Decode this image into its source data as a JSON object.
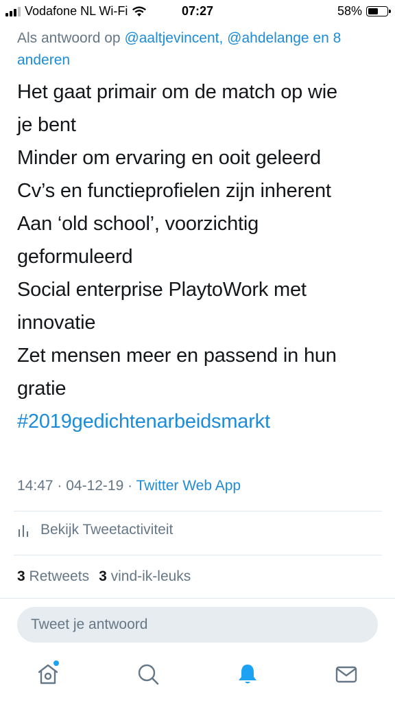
{
  "status_bar": {
    "carrier": "Vodafone NL Wi-Fi",
    "time": "07:27",
    "battery_percent": "58%",
    "battery_level": 0.58,
    "signal_bars_filled": 3,
    "signal_bars_total": 4
  },
  "tweet": {
    "reply_prefix": "Als antwoord op ",
    "reply_mentions": "@aaltjevincent, @ahdelange en 8 anderen",
    "lines": [
      "Het gaat primair om de match op wie",
      "je bent",
      "Minder om ervaring en ooit geleerd",
      "Cv’s en functieprofielen zijn inherent",
      "Aan ‘old school’, voorzichtig",
      "geformuleerd",
      "Social enterprise PlaytoWork met",
      "innovatie",
      "Zet mensen meer en passend in hun",
      "gratie"
    ],
    "hashtag": "#2019gedichtenarbeidsmarkt",
    "timestamp": "14:47 · 04-12-19 · ",
    "source": "Twitter Web App"
  },
  "activity": {
    "label": "Bekijk Tweetactiviteit",
    "icon": "bar-chart-icon"
  },
  "stats": {
    "retweets_count": "3",
    "retweets_label": "Retweets",
    "likes_count": "3",
    "likes_label": "vind-ik-leuks"
  },
  "reply": {
    "placeholder": "Tweet je antwoord"
  },
  "bottom_nav": {
    "items": [
      {
        "name": "home",
        "icon": "home-icon",
        "has_dot": true
      },
      {
        "name": "search",
        "icon": "search-icon"
      },
      {
        "name": "notifications",
        "icon": "bell-icon",
        "active": true
      },
      {
        "name": "messages",
        "icon": "envelope-icon"
      }
    ]
  },
  "colors": {
    "accent": "#1d8cd8",
    "muted": "#657786",
    "text": "#14171a",
    "reply_bg": "#e6ecf0",
    "divider": "#e1e8ed"
  }
}
